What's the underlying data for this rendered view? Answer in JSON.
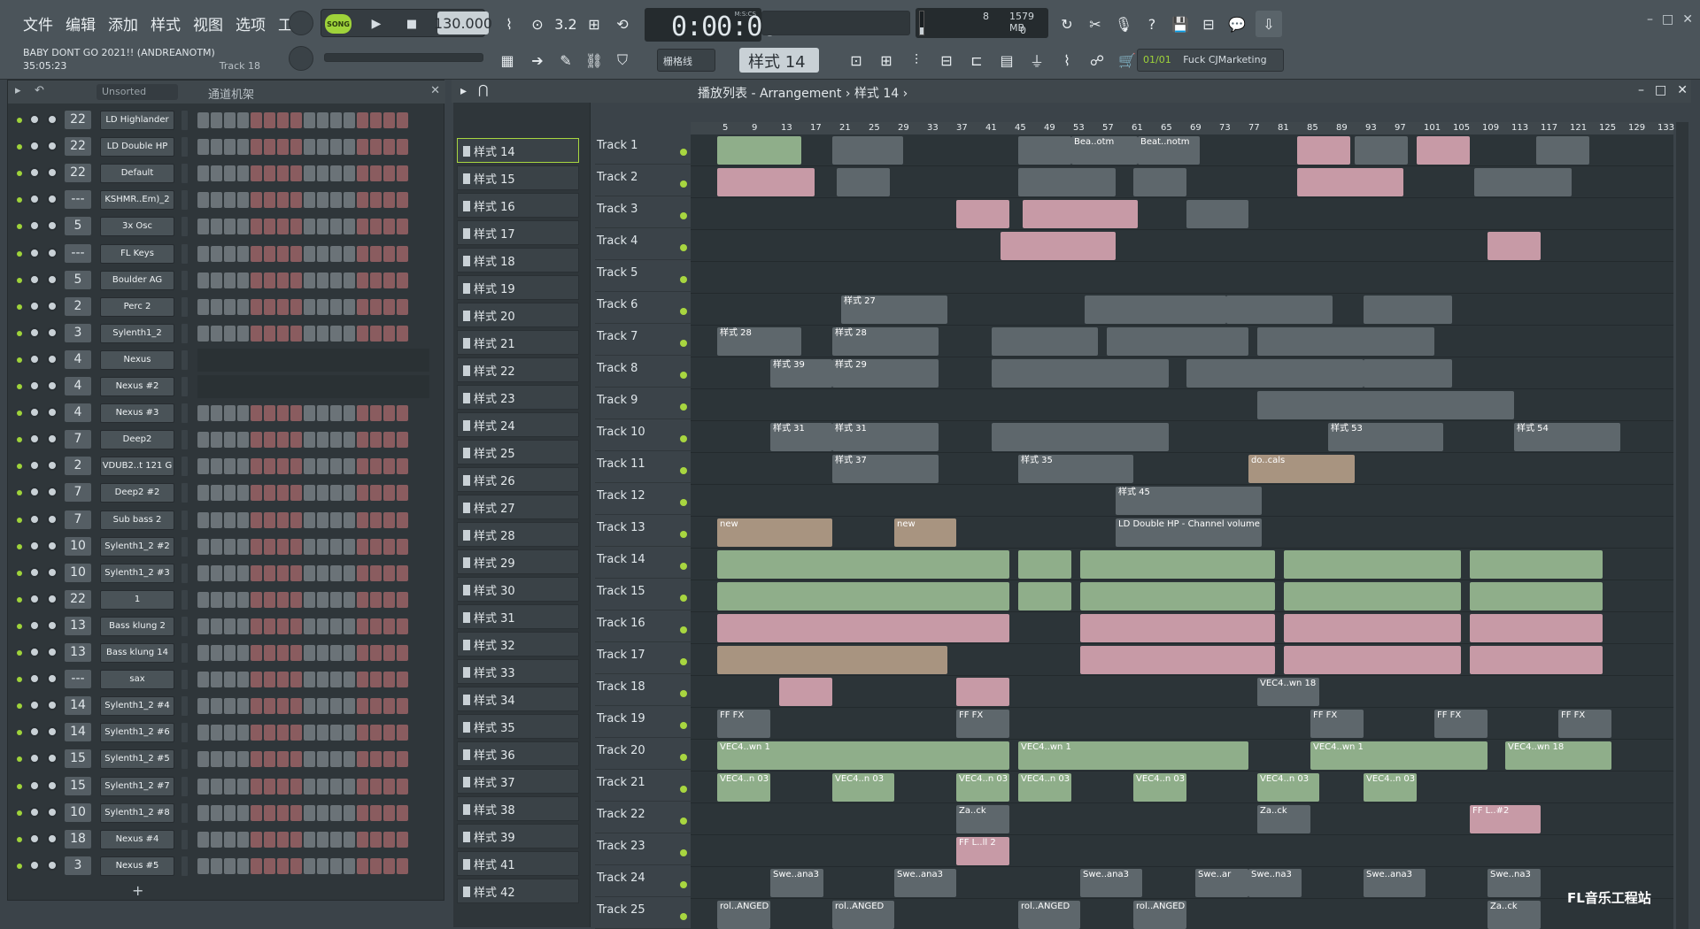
{
  "menu": [
    "文件",
    "编辑",
    "添加",
    "样式",
    "视图",
    "选项",
    "工具",
    "帮助"
  ],
  "project": {
    "title": "BABY DONT GO 2021!! (ANDREANOTM)",
    "time": "35:05:23",
    "track": "Track 18"
  },
  "transport": {
    "mode": "SONG",
    "tempo": "130.000",
    "time": "0:00:00",
    "time_label": "M:S:CS"
  },
  "cpu": {
    "value": "8",
    "memory": "1579 MB",
    "zero": "0"
  },
  "snap": "栅格线",
  "pattern": "样式 14",
  "hint": {
    "count": "01/01",
    "text": "Fuck CJMarketing"
  },
  "rack": {
    "sort": "Unsorted",
    "title": "通道机架",
    "add": "+"
  },
  "channels": [
    {
      "num": "22",
      "name": "LD Highlander"
    },
    {
      "num": "22",
      "name": "LD Double HP"
    },
    {
      "num": "22",
      "name": "Default"
    },
    {
      "num": "---",
      "name": "KSHMR..Em)_2"
    },
    {
      "num": "5",
      "name": "3x Osc"
    },
    {
      "num": "---",
      "name": "FL Keys"
    },
    {
      "num": "5",
      "name": "Boulder AG"
    },
    {
      "num": "2",
      "name": "Perc 2"
    },
    {
      "num": "3",
      "name": "Sylenth1_2"
    },
    {
      "num": "4",
      "name": "Nexus"
    },
    {
      "num": "4",
      "name": "Nexus #2"
    },
    {
      "num": "4",
      "name": "Nexus #3"
    },
    {
      "num": "7",
      "name": "Deep2"
    },
    {
      "num": "2",
      "name": "VDUB2..t 121 G"
    },
    {
      "num": "7",
      "name": "Deep2 #2"
    },
    {
      "num": "7",
      "name": "Sub bass 2"
    },
    {
      "num": "10",
      "name": "Sylenth1_2 #2"
    },
    {
      "num": "10",
      "name": "Sylenth1_2 #3"
    },
    {
      "num": "22",
      "name": "1"
    },
    {
      "num": "13",
      "name": "Bass  klung 2"
    },
    {
      "num": "13",
      "name": "Bass  klung 14"
    },
    {
      "num": "---",
      "name": "sax"
    },
    {
      "num": "14",
      "name": "Sylenth1_2 #4"
    },
    {
      "num": "14",
      "name": "Sylenth1_2 #6"
    },
    {
      "num": "15",
      "name": "Sylenth1_2 #5"
    },
    {
      "num": "15",
      "name": "Sylenth1_2 #7"
    },
    {
      "num": "10",
      "name": "Sylenth1_2 #8"
    },
    {
      "num": "18",
      "name": "Nexus #4"
    },
    {
      "num": "3",
      "name": "Nexus #5"
    }
  ],
  "patterns": [
    "样式 14",
    "样式 15",
    "样式 16",
    "样式 17",
    "样式 18",
    "样式 19",
    "样式 20",
    "样式 21",
    "样式 22",
    "样式 23",
    "样式 24",
    "样式 25",
    "样式 26",
    "样式 27",
    "样式 28",
    "样式 29",
    "样式 30",
    "样式 31",
    "样式 32",
    "样式 33",
    "样式 34",
    "样式 35",
    "样式 36",
    "样式 37",
    "样式 38",
    "样式 39",
    "样式 41",
    "样式 42"
  ],
  "playlist": {
    "title": "播放列表 - Arrangement",
    "crumb": "样式 14"
  },
  "ruler": [
    "5",
    "9",
    "13",
    "17",
    "21",
    "25",
    "29",
    "33",
    "37",
    "41",
    "45",
    "49",
    "53",
    "57",
    "61",
    "65",
    "69",
    "73",
    "77",
    "81",
    "85",
    "89",
    "93",
    "97",
    "101",
    "105",
    "109",
    "113",
    "117",
    "121",
    "125",
    "129",
    "133"
  ],
  "tracks": [
    "Track 1",
    "Track 2",
    "Track 3",
    "Track 4",
    "Track 5",
    "Track 6",
    "Track 7",
    "Track 8",
    "Track 9",
    "Track 10",
    "Track 11",
    "Track 12",
    "Track 13",
    "Track 14",
    "Track 15",
    "Track 16",
    "Track 17",
    "Track 18",
    "Track 19",
    "Track 20",
    "Track 21",
    "Track 22",
    "Track 23",
    "Track 24",
    "Track 25"
  ],
  "clip_labels": {
    "t1a": "Bea..otm",
    "t1b": "Beat..notm",
    "t6": "样式 27",
    "t7": "样式 28",
    "t8": "样式 39",
    "t8b": "样式 29",
    "t10": "样式 31",
    "t10b": "样式 53",
    "t10c": "样式 54",
    "t11": "样式 37",
    "t11b": "样式 35",
    "t11c": "do..cals",
    "t12": "样式 45",
    "t13": "new",
    "t13b": "LD Double HP - Channel volume",
    "t18": "VEC4..wn 18",
    "t19": "FF FX",
    "t20": "VEC4..wn 1",
    "t20b": "VEC4..wn 18",
    "t21": "VEC4..n 03",
    "t22": "Za..ck",
    "t22b": "FF L..#2",
    "t23": "FF L..ll 2",
    "t24": "Swe..ana3",
    "t24b": "Swe..ar",
    "t24c": "Swe..na3",
    "t25": "rol..ANGED"
  },
  "colors": {
    "accent": "#a8d640",
    "clip_green": "#8fae8a",
    "clip_pink": "#c79aa6",
    "clip_tan": "#a89480",
    "clip_gray": "#5e676c",
    "record": "#e2453f"
  },
  "watermark": "FL音乐工程站"
}
